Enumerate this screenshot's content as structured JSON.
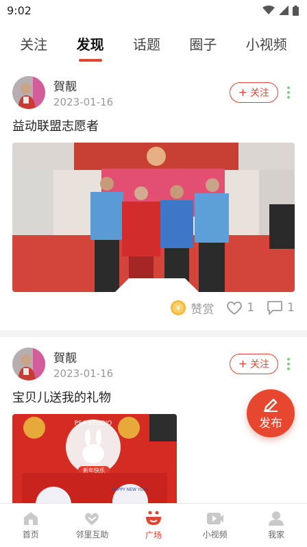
{
  "status_bar": {
    "time": "9:02"
  },
  "tabs": [
    {
      "label": "关注",
      "active": false
    },
    {
      "label": "发现",
      "active": true
    },
    {
      "label": "话题",
      "active": false
    },
    {
      "label": "圈子",
      "active": false
    },
    {
      "label": "小视频",
      "active": false
    }
  ],
  "posts": [
    {
      "user": "賀靓",
      "date": "2023-01-16",
      "follow_label": "关注",
      "title": "益动联盟志愿者",
      "image": "group-photo-volunteers",
      "reward_label": "赞赏",
      "likes": "1",
      "comments": "1"
    },
    {
      "user": "賀靓",
      "date": "2023-01-16",
      "follow_label": "关注",
      "title": "宝贝儿送我的礼物",
      "image": "red-gift-box-rabbit",
      "photo_text_top": "PSA STUDIO",
      "photo_text_badge": "新年快乐",
      "photo_text_tag": "HAPPY NEW YEAR"
    }
  ],
  "fab": {
    "label": "发布",
    "icon": "pencil-icon"
  },
  "bottom_nav": [
    {
      "label": "首页",
      "icon": "home-icon",
      "active": false
    },
    {
      "label": "邻里互助",
      "icon": "handshake-icon",
      "active": false
    },
    {
      "label": "广场",
      "icon": "square-bowl-icon",
      "active": true
    },
    {
      "label": "小视频",
      "icon": "video-icon",
      "active": false
    },
    {
      "label": "我家",
      "icon": "person-icon",
      "active": false
    }
  ],
  "colors": {
    "accent": "#e0462f",
    "follow_dots": "#7ed086",
    "inactive": "#999999"
  }
}
